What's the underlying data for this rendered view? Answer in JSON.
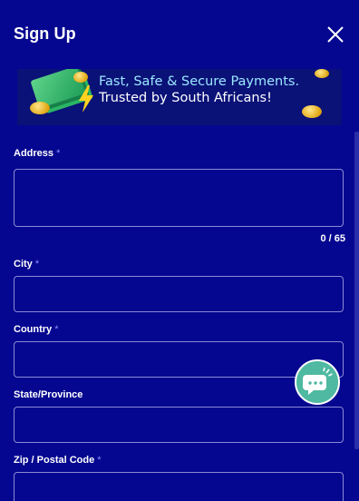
{
  "header": {
    "title": "Sign Up",
    "close_icon": "close-icon"
  },
  "banner": {
    "line1": "Fast, Safe & Secure Payments.",
    "line2": "Trusted by South Africans!"
  },
  "form": {
    "address": {
      "label": "Address",
      "required": "*",
      "value": "",
      "counter": "0 / 65"
    },
    "city": {
      "label": "City",
      "required": "*",
      "value": ""
    },
    "country": {
      "label": "Country",
      "required": "*",
      "value": ""
    },
    "state": {
      "label": "State/Province",
      "value": ""
    },
    "zip": {
      "label": "Zip / Postal Code",
      "required": "*",
      "value": ""
    }
  },
  "chat": {
    "icon": "chat-support-icon"
  },
  "colors": {
    "background": "#050790",
    "accent_required": "#8c8cff",
    "chat_button": "#4fb9a1",
    "banner_highlight": "#9be7ff"
  }
}
